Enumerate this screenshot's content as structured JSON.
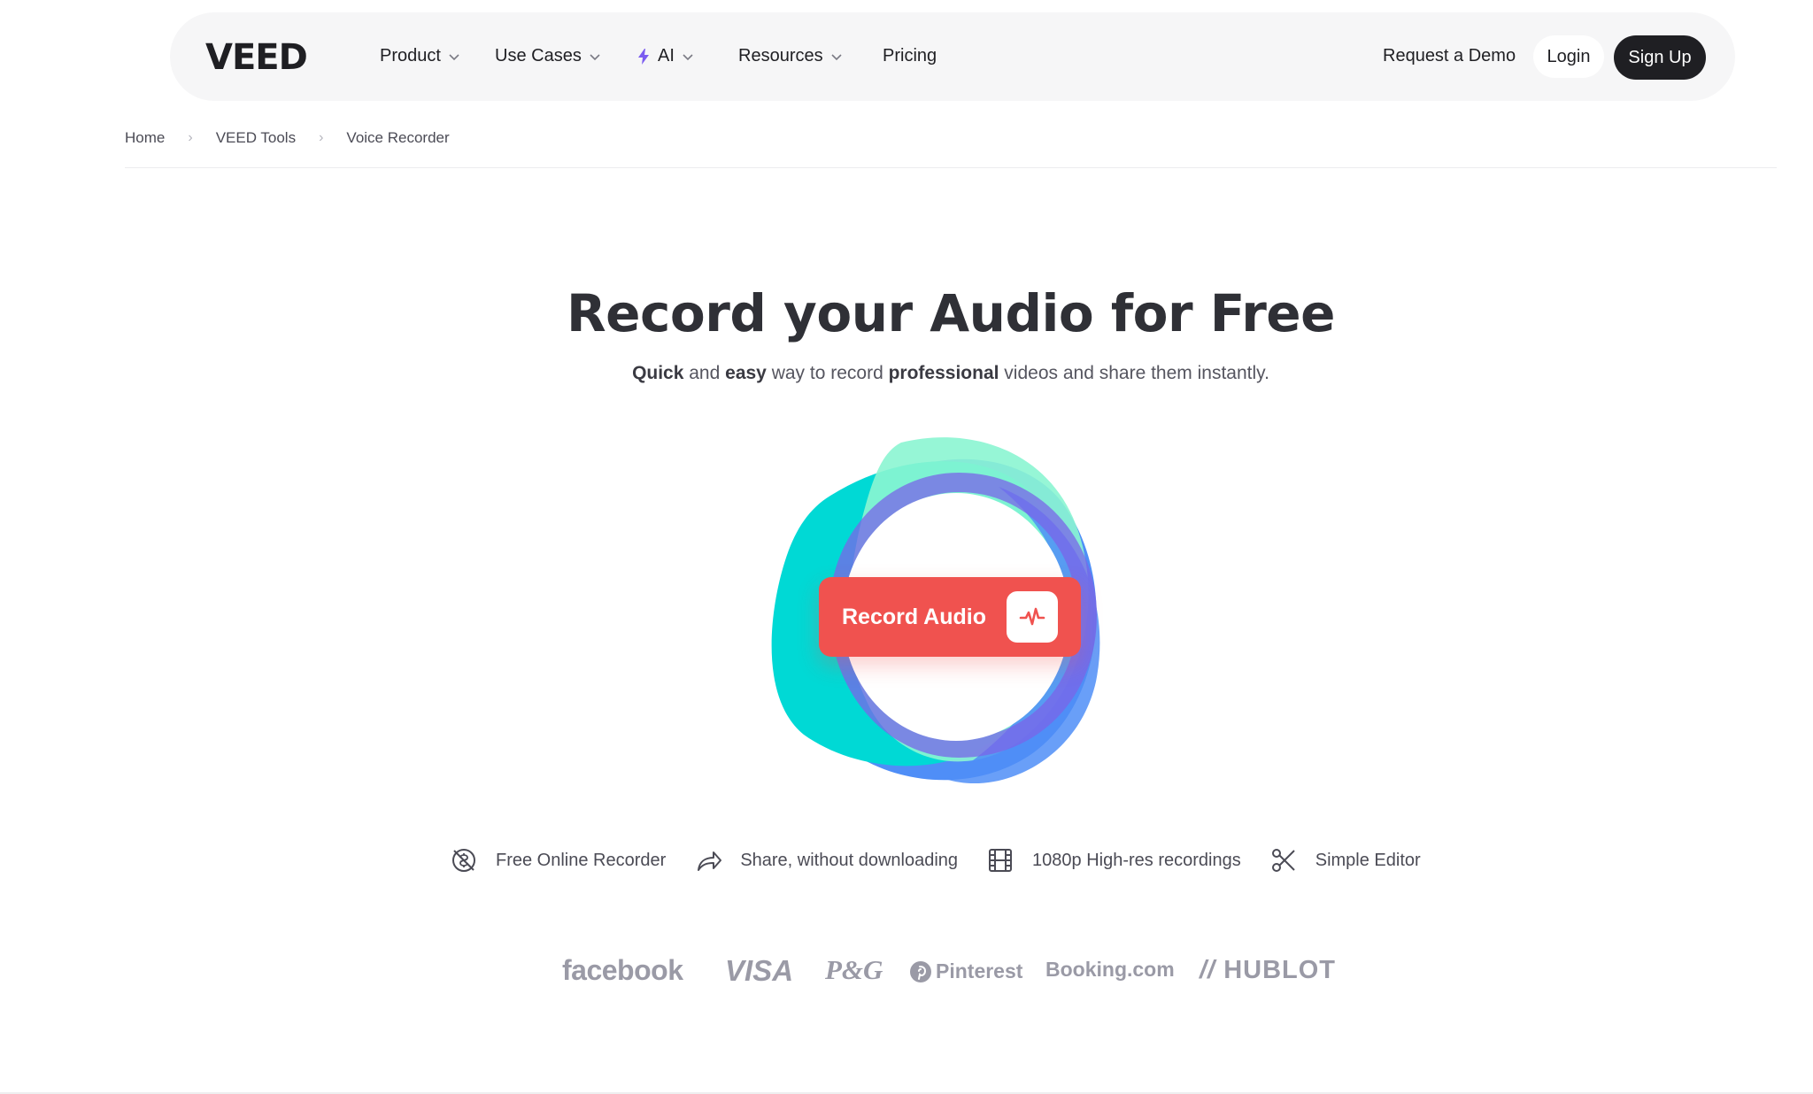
{
  "nav": {
    "logo": "VEED",
    "items": [
      {
        "label": "Product",
        "has_dropdown": true
      },
      {
        "label": "Use Cases",
        "has_dropdown": true
      },
      {
        "label": "AI",
        "has_dropdown": true,
        "icon": "bolt-icon"
      },
      {
        "label": "Resources",
        "has_dropdown": true
      },
      {
        "label": "Pricing",
        "has_dropdown": false
      }
    ],
    "request_demo": "Request a Demo",
    "login": "Login",
    "signup": "Sign Up"
  },
  "breadcrumb": [
    "Home",
    "VEED Tools",
    "Voice Recorder"
  ],
  "hero": {
    "title": "Record your Audio for Free",
    "subtitle": {
      "quick": "Quick",
      "and": " and ",
      "easy": "easy",
      "mid": " way to record ",
      "professional": "professional",
      "end": " videos and share them instantly."
    },
    "record_button": "Record Audio"
  },
  "features": [
    {
      "label": "Free Online Recorder",
      "icon": "no-money-icon"
    },
    {
      "label": "Share, without downloading",
      "icon": "share-arrow-icon"
    },
    {
      "label": "1080p High-res recordings",
      "icon": "film-icon"
    },
    {
      "label": "Simple Editor",
      "icon": "scissors-icon"
    }
  ],
  "brands": [
    "facebook",
    "VISA",
    "P&G",
    "Pinterest",
    "Booking.com",
    "HUBLOT"
  ],
  "colors": {
    "accent": "#f0524f",
    "dark": "#1f1f23",
    "blob_teal": "#00d9d5",
    "blob_mint": "#8bf5d2",
    "blob_blue": "#4f8ef7",
    "blob_violet": "#7a64e8",
    "ai_bolt": "#7b5cf0"
  }
}
